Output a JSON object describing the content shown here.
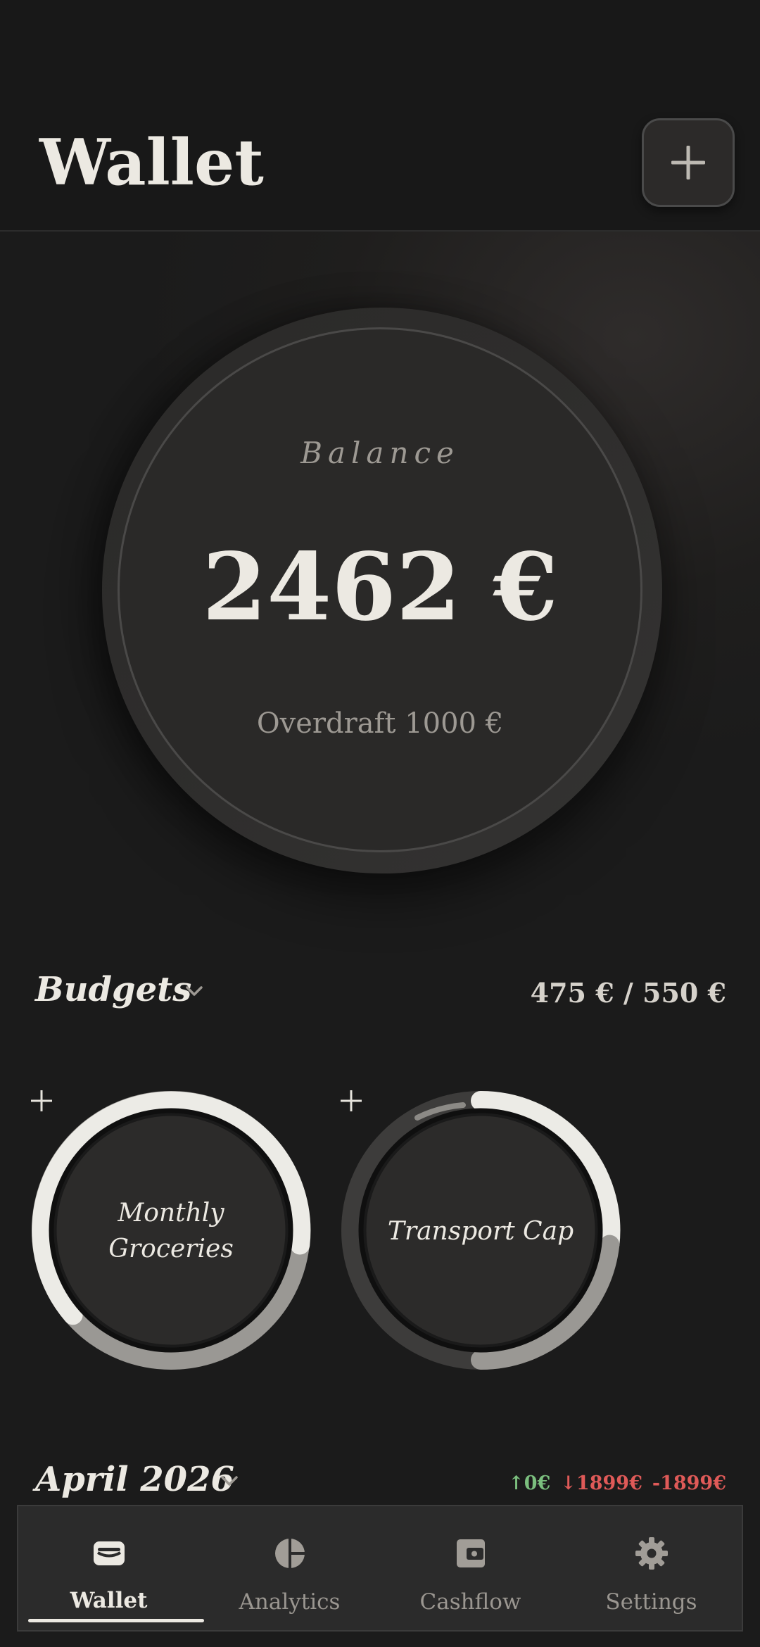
{
  "header": {
    "title": "Wallet",
    "add_icon": "plus-icon"
  },
  "balance": {
    "label": "Balance",
    "amount": "2462 €",
    "overdraft": "Overdraft 1000 €"
  },
  "budgets": {
    "title": "Budgets",
    "total": "475 € / 550 €",
    "items": [
      {
        "name_line1": "Monthly",
        "name_line2": "Groceries",
        "add_icon": "plus-icon"
      },
      {
        "name": "Transport Cap",
        "add_icon": "plus-icon"
      }
    ]
  },
  "month": {
    "title": "April 2026",
    "income": "↑0€",
    "expense": "↓1899€",
    "net": "-1899€"
  },
  "nav": {
    "items": [
      {
        "label": "Wallet",
        "icon": "wallet-icon",
        "active": true
      },
      {
        "label": "Analytics",
        "icon": "pie-chart-icon",
        "active": false
      },
      {
        "label": "Cashflow",
        "icon": "cashflow-icon",
        "active": false
      },
      {
        "label": "Settings",
        "icon": "gear-icon",
        "active": false
      }
    ]
  },
  "colors": {
    "background": "#1b1b1b",
    "surface": "#2a2928",
    "text": "#ece9e2",
    "muted": "#9d9993",
    "income": "#7bbf7e",
    "expense": "#df5a58"
  }
}
